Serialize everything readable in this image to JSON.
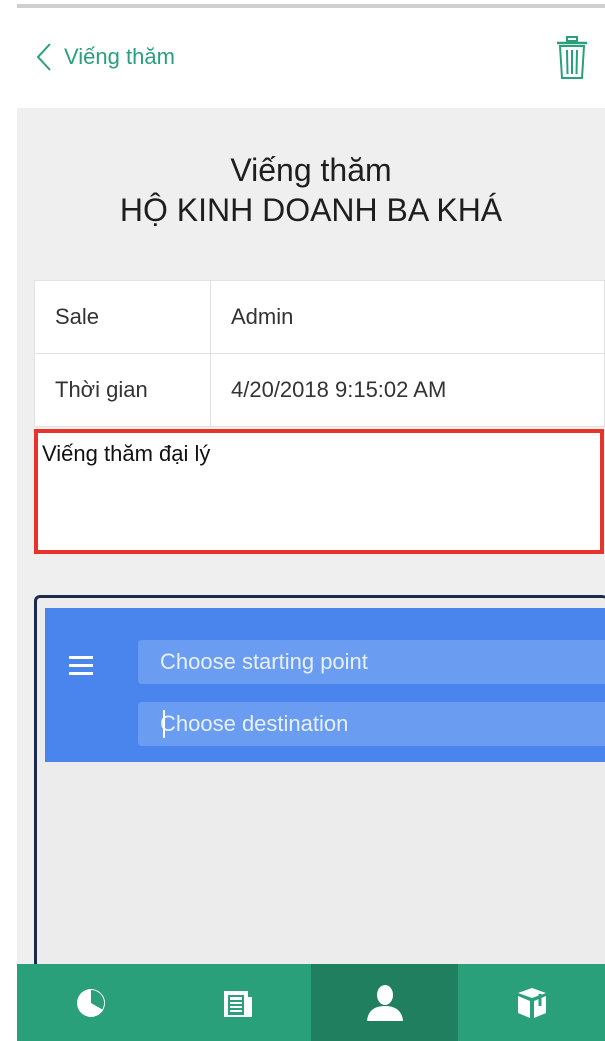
{
  "nav": {
    "back_label": "Viếng thăm",
    "back_icon": "chevron-left-icon",
    "trash_icon": "trash-icon"
  },
  "header": {
    "title_line1": "Viếng thăm",
    "title_line2": "HỘ KINH DOANH BA KHÁ"
  },
  "details": [
    {
      "label": "Sale",
      "value": "Admin"
    },
    {
      "label": "Thời gian",
      "value": "4/20/2018 9:15:02 AM"
    }
  ],
  "note": {
    "text": "Viếng thăm đại lý"
  },
  "map": {
    "menu_icon": "menu-icon",
    "start_placeholder": "Choose starting point",
    "destination_placeholder": "Choose destination"
  },
  "tabs": [
    {
      "icon": "pie-chart-icon",
      "active": false
    },
    {
      "icon": "newspaper-icon",
      "active": false
    },
    {
      "icon": "user-icon",
      "active": true
    },
    {
      "icon": "package-icon",
      "active": false
    }
  ],
  "colors": {
    "brand_green": "#2aa07a",
    "tab_active": "#1f7f5f",
    "highlight_red": "#e8332c",
    "map_blue": "#4a85ee"
  }
}
